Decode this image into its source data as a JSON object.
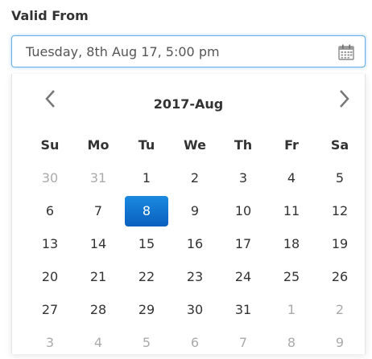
{
  "field": {
    "label": "Valid From",
    "value": "Tuesday, 8th Aug 17, 5:00 pm"
  },
  "icons": {
    "calendar": "calendar-icon",
    "prev": "chevron-left-icon",
    "next": "chevron-right-icon"
  },
  "colors": {
    "accent": "#0a6fd6",
    "focus_border": "#66afe9",
    "muted_text": "#aaaaaa"
  },
  "calendar": {
    "title": "2017-Aug",
    "weekdays": [
      "Su",
      "Mo",
      "Tu",
      "We",
      "Th",
      "Fr",
      "Sa"
    ],
    "weeks": [
      [
        {
          "d": "30",
          "m": true
        },
        {
          "d": "31",
          "m": true
        },
        {
          "d": "1"
        },
        {
          "d": "2"
        },
        {
          "d": "3"
        },
        {
          "d": "4"
        },
        {
          "d": "5"
        }
      ],
      [
        {
          "d": "6"
        },
        {
          "d": "7"
        },
        {
          "d": "8",
          "s": true
        },
        {
          "d": "9"
        },
        {
          "d": "10"
        },
        {
          "d": "11"
        },
        {
          "d": "12"
        }
      ],
      [
        {
          "d": "13"
        },
        {
          "d": "14"
        },
        {
          "d": "15"
        },
        {
          "d": "16"
        },
        {
          "d": "17"
        },
        {
          "d": "18"
        },
        {
          "d": "19"
        }
      ],
      [
        {
          "d": "20"
        },
        {
          "d": "21"
        },
        {
          "d": "22"
        },
        {
          "d": "23"
        },
        {
          "d": "24"
        },
        {
          "d": "25"
        },
        {
          "d": "26"
        }
      ],
      [
        {
          "d": "27"
        },
        {
          "d": "28"
        },
        {
          "d": "29"
        },
        {
          "d": "30"
        },
        {
          "d": "31"
        },
        {
          "d": "1",
          "m": true
        },
        {
          "d": "2",
          "m": true
        }
      ],
      [
        {
          "d": "3",
          "m": true
        },
        {
          "d": "4",
          "m": true
        },
        {
          "d": "5",
          "m": true
        },
        {
          "d": "6",
          "m": true
        },
        {
          "d": "7",
          "m": true
        },
        {
          "d": "8",
          "m": true
        },
        {
          "d": "9",
          "m": true
        }
      ]
    ]
  }
}
